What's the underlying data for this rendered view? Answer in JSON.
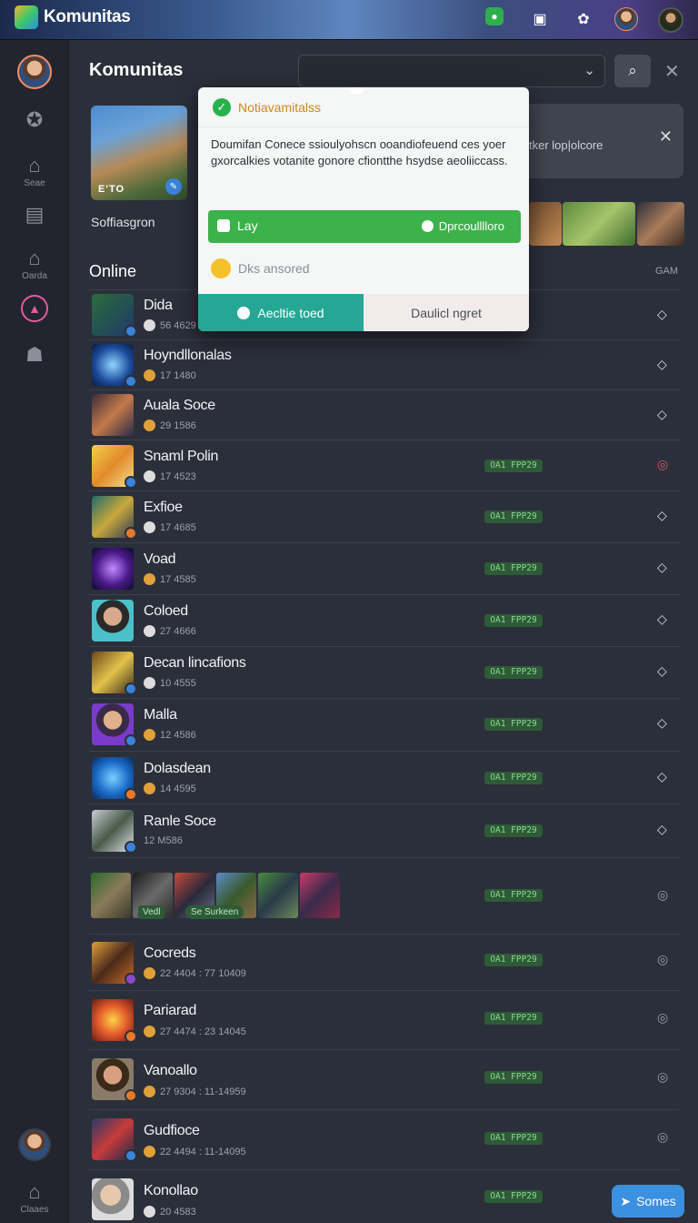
{
  "topbar": {
    "brand": "Komunitas",
    "icons": [
      "chat-icon",
      "shop-icon",
      "settings-icon",
      "profile-avatar",
      "friend-avatar"
    ]
  },
  "sidebar": {
    "items": [
      {
        "icon": "profile-avatar",
        "label": ""
      },
      {
        "icon": "badge-icon",
        "label": ""
      },
      {
        "icon": "home-icon",
        "label": "Seae"
      },
      {
        "icon": "document-icon",
        "label": ""
      },
      {
        "icon": "home-icon",
        "label": "Oarda"
      },
      {
        "icon": "triangle-icon",
        "label": ""
      },
      {
        "icon": "group-icon",
        "label": ""
      },
      {
        "icon": "user-avatar",
        "label": ""
      },
      {
        "icon": "home-icon",
        "label": "Claaes"
      }
    ]
  },
  "main": {
    "title": "Komunitas",
    "hero": {
      "thumb_text": "E'TO",
      "label": "Soffiasgron",
      "card_text": "tker lop|olcore"
    },
    "section": "Online",
    "column_label": "GAM"
  },
  "popup": {
    "title": "Notiavamitalss",
    "body": "Doumifan Conece ssioulyohscn ooandiofeuend ces yoer gxorcalkies votanite gonore cfiontthe hsydse aeoliiccass.",
    "bar_left": "Lay",
    "bar_right": "Dprcoulllloro",
    "hint": "Dks ansored",
    "btn_primary": "Aecltie toed",
    "btn_secondary": "Daulicl ngret"
  },
  "rows": [
    {
      "name": "Dida",
      "meta": "56 4629",
      "tag": "",
      "action": "diamond-icon"
    },
    {
      "name": "Hoyndllonalas",
      "meta": "17 1480",
      "tag": "",
      "action": "diamond-icon"
    },
    {
      "name": "Auala Soce",
      "meta": "29 1586",
      "tag": "",
      "action": "diamond-icon"
    },
    {
      "name": "Snaml Polin",
      "meta": "17 4523",
      "tag": "OA1 FPP29",
      "action": "check-circle-icon"
    },
    {
      "name": "Exfioe",
      "meta": "17 4685",
      "tag": "OA1 FPP29",
      "action": "diamond-icon"
    },
    {
      "name": "Voad",
      "meta": "17 4585",
      "tag": "OA1 FPP29",
      "action": "diamond-icon"
    },
    {
      "name": "Coloed",
      "meta": "27 4666",
      "tag": "OA1 FPP29",
      "action": "diamond-icon"
    },
    {
      "name": "Decan lincafions",
      "meta": "10 4555",
      "tag": "OA1 FPP29",
      "action": "diamond-icon"
    },
    {
      "name": "Malla",
      "meta": "12 4586",
      "tag": "OA1 FPP29",
      "action": "diamond-icon"
    },
    {
      "name": "Dolasdean",
      "meta": "14 4595",
      "tag": "OA1 FPP29",
      "action": "diamond-icon"
    },
    {
      "name": "Ranle Soce",
      "meta": "12 M586",
      "tag": "OA1 FPP29",
      "action": "diamond-icon"
    }
  ],
  "gallery": {
    "badge1": "Vedl",
    "badge2": "Se Surkeen",
    "tag": "OA1 FPP29"
  },
  "rows2": [
    {
      "name": "Cocreds",
      "meta": "22 4404 : 77 10409",
      "tag": "OA1 FPP29"
    },
    {
      "name": "Pariarad",
      "meta": "27 4474 : 23 14045",
      "tag": "OA1 FPP29"
    },
    {
      "name": "Vanoallo",
      "meta": "27 9304 : 11-14959",
      "tag": "OA1 FPP29"
    },
    {
      "name": "Gudfioce",
      "meta": "22 4494 : 11-14095",
      "tag": "OA1 FPP29"
    },
    {
      "name": "Konollao",
      "meta": "20 4583",
      "tag": "OA1 FPP29"
    }
  ],
  "fab": {
    "label": "Somes"
  },
  "colors": {
    "accent": "#3cb34a",
    "teal": "#26a795",
    "tag_bg": "#2e5a38",
    "fab": "#3d8fe0"
  }
}
